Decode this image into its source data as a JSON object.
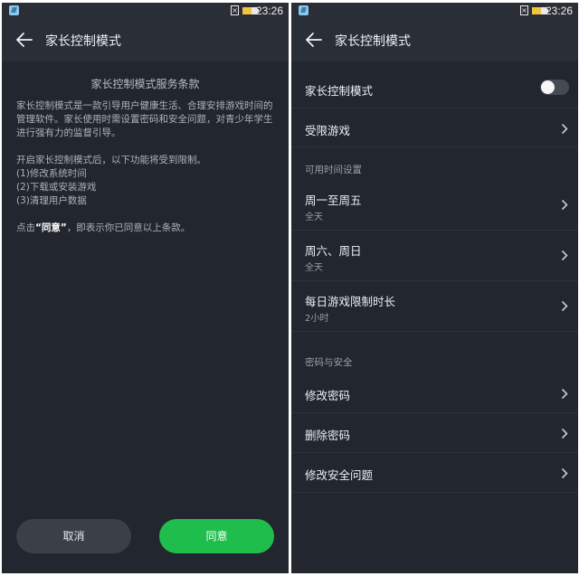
{
  "status_bar": {
    "time": "23:26",
    "battery_level": 0.65
  },
  "left": {
    "title": "家长控制模式",
    "terms_title": "家长控制模式服务条款",
    "paragraph1": "家长控制模式是一款引导用户健康生活、合理安排游戏时间的管理软件。家长使用时需设置密码和安全问题，对青少年学生进行强有力的监督引导。",
    "paragraph2_intro": "开启家长控制模式后，以下功能将受到限制。",
    "restrictions": [
      "(1)修改系统时间",
      "(2)下载或安装游戏",
      "(3)清理用户数据"
    ],
    "agree_prefix": "点击",
    "agree_quoted": "“同意”",
    "agree_suffix": "，即表示你已同意以上条款。",
    "cancel_label": "取消",
    "agree_label": "同意"
  },
  "right": {
    "title": "家长控制模式",
    "parental_mode_label": "家长控制模式",
    "parental_mode_enabled": false,
    "restricted_games_label": "受限游戏",
    "time_section_label": "可用时间设置",
    "weekdays_label": "周一至周五",
    "weekdays_value": "全天",
    "weekend_label": "周六、周日",
    "weekend_value": "全天",
    "daily_limit_label": "每日游戏限制时长",
    "daily_limit_value": "2小时",
    "security_section_label": "密码与安全",
    "change_password_label": "修改密码",
    "delete_password_label": "删除密码",
    "change_security_question_label": "修改安全问题"
  },
  "colors": {
    "accent_green": "#1fbe4c",
    "background": "#22262e"
  }
}
